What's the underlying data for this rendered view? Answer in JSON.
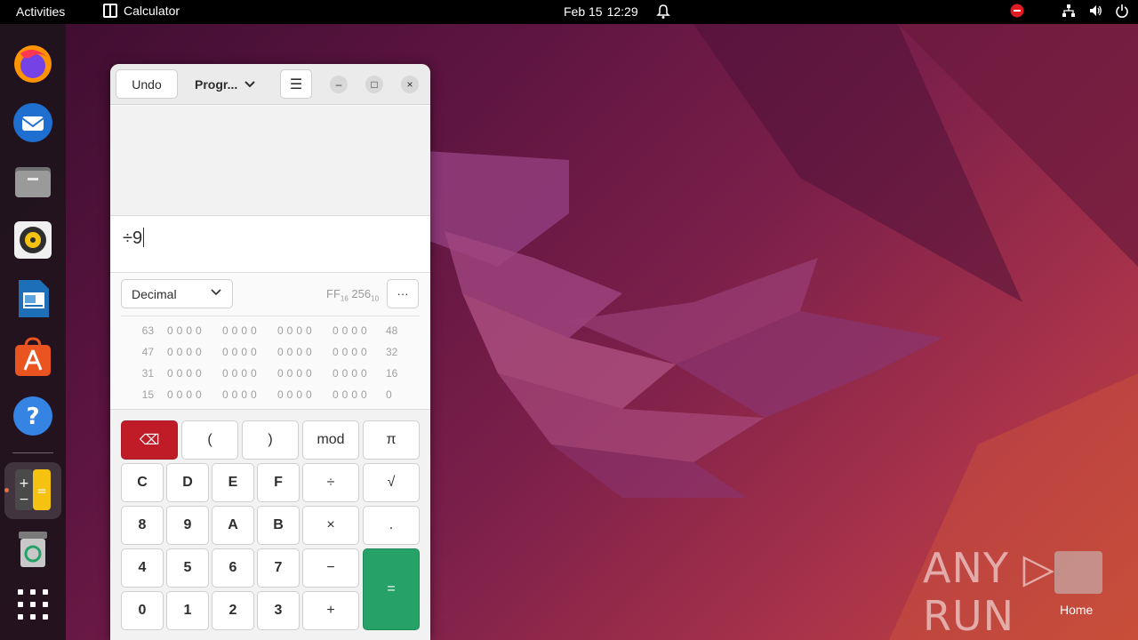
{
  "topbar": {
    "activities": "Activities",
    "app_name": "Calculator",
    "date": "Feb 15",
    "time": "12:29"
  },
  "dock": {
    "items": [
      "firefox-icon",
      "thunderbird-icon",
      "files-icon",
      "rhythmbox-icon",
      "libreoffice-writer-icon",
      "app-center-icon",
      "help-icon",
      "calculator-icon",
      "trash-icon",
      "show-apps-icon"
    ]
  },
  "window": {
    "undo_label": "Undo",
    "mode_label": "Progr...",
    "menu_glyph": "☰",
    "minimize_glyph": "–",
    "maximize_glyph": "□",
    "close_glyph": "×"
  },
  "entry": {
    "value": "÷9"
  },
  "base": {
    "selected": "Decimal",
    "hex_value": "FF",
    "hex_sub": "16",
    "dec_value": "256",
    "dec_sub": "10",
    "more_glyph": "···"
  },
  "bits": {
    "rows": [
      {
        "left": "63",
        "groups": [
          "0000",
          "0000",
          "0000",
          "0000"
        ],
        "right": "48"
      },
      {
        "left": "47",
        "groups": [
          "0000",
          "0000",
          "0000",
          "0000"
        ],
        "right": "32"
      },
      {
        "left": "31",
        "groups": [
          "0000",
          "0000",
          "0000",
          "0000"
        ],
        "right": "16"
      },
      {
        "left": "15",
        "groups": [
          "0000",
          "0000",
          "0000",
          "0000"
        ],
        "right": "0"
      }
    ]
  },
  "keys": {
    "backspace": "⌫",
    "lparen": "(",
    "rparen": ")",
    "mod": "mod",
    "pi": "π",
    "C": "C",
    "D": "D",
    "E": "E",
    "F": "F",
    "divide": "÷",
    "sqrt": "√",
    "k8": "8",
    "k9": "9",
    "A": "A",
    "B": "B",
    "multiply": "×",
    "point": ".",
    "k4": "4",
    "k5": "5",
    "k6": "6",
    "k7": "7",
    "subtract": "−",
    "equals": "=",
    "k0": "0",
    "k1": "1",
    "k2": "2",
    "k3": "3",
    "add": "+"
  },
  "desktop": {
    "watermark": "ANY ▷ RUN",
    "home_label": "Home"
  }
}
